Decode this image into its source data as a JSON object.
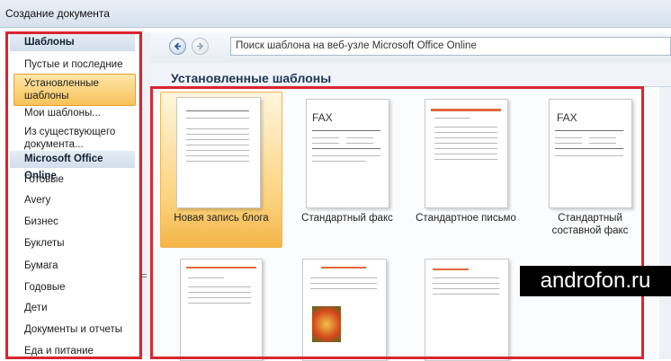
{
  "window": {
    "title": "Создание документа"
  },
  "sidebar": {
    "items": [
      {
        "label": "Шаблоны",
        "type": "header"
      },
      {
        "label": "Пустые и последние"
      },
      {
        "label": "Установленные шаблоны",
        "selected": true
      },
      {
        "label": "Мои шаблоны..."
      },
      {
        "label": "Из существующего документа..."
      },
      {
        "label": "Microsoft Office Online",
        "type": "header"
      },
      {
        "label": "Готовые"
      },
      {
        "label": "Avery"
      },
      {
        "label": "Бизнес"
      },
      {
        "label": "Буклеты"
      },
      {
        "label": "Бумага"
      },
      {
        "label": "Годовые"
      },
      {
        "label": "Дети"
      },
      {
        "label": "Документы и отчеты"
      },
      {
        "label": "Еда и питание"
      }
    ]
  },
  "toolbar": {
    "search_placeholder": "Поиск шаблона на веб-узле Microsoft Office Online"
  },
  "main": {
    "section_title": "Установленные шаблоны",
    "templates": [
      {
        "label": "Новая запись блога",
        "selected": true
      },
      {
        "label": "Стандартный факс",
        "thumb_text": "FAX"
      },
      {
        "label": "Стандартное письмо"
      },
      {
        "label": "Стандартный составной факс",
        "thumb_text": "FAX"
      }
    ]
  },
  "watermark": {
    "text": "androfon.ru"
  },
  "colors": {
    "highlight": "#d9262e",
    "selection": "#f8c25a",
    "accent": "#e0693c"
  }
}
